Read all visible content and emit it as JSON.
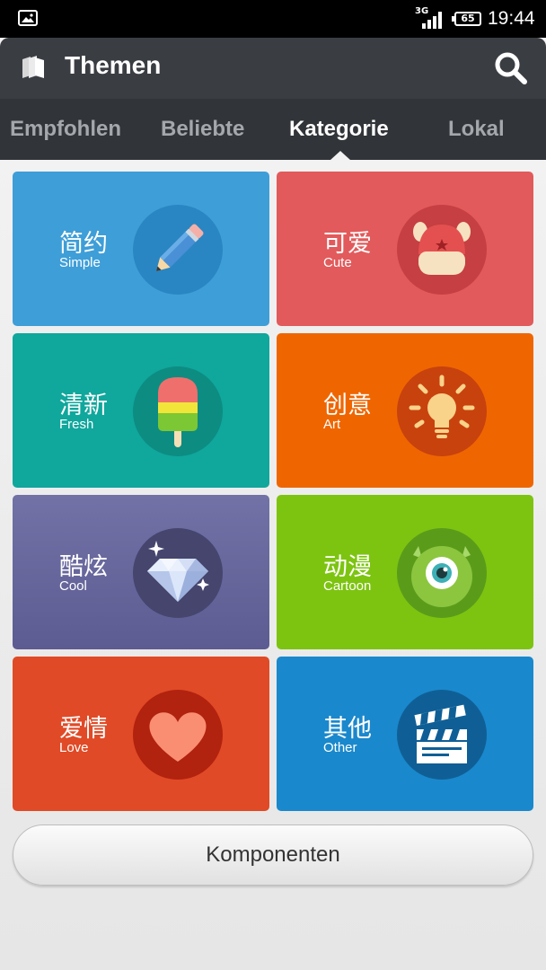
{
  "status_bar": {
    "network": "3G",
    "battery": "65",
    "time": "19:44"
  },
  "header": {
    "title": "Themen"
  },
  "tabs": [
    {
      "label": "Empfohlen",
      "active": false
    },
    {
      "label": "Beliebte",
      "active": false
    },
    {
      "label": "Kategorie",
      "active": true
    },
    {
      "label": "Lokal",
      "active": false
    }
  ],
  "categories": [
    {
      "cn": "简约",
      "en": "Simple",
      "color": "#3e9ed8",
      "icon": "pencil-icon"
    },
    {
      "cn": "可爱",
      "en": "Cute",
      "color": "#e25a5b",
      "icon": "cute-face-icon"
    },
    {
      "cn": "清新",
      "en": "Fresh",
      "color": "#10a79c",
      "icon": "popsicle-icon"
    },
    {
      "cn": "创意",
      "en": "Art",
      "color": "#ef6601",
      "icon": "lightbulb-icon"
    },
    {
      "cn": "酷炫",
      "en": "Cool",
      "color": "#6a6a9f",
      "icon": "diamond-icon"
    },
    {
      "cn": "动漫",
      "en": "Cartoon",
      "color": "#7dc410",
      "icon": "eyeball-monster-icon"
    },
    {
      "cn": "爱情",
      "en": "Love",
      "color": "#e04a26",
      "icon": "heart-icon"
    },
    {
      "cn": "其他",
      "en": "Other",
      "color": "#1a88cc",
      "icon": "clapperboard-icon"
    }
  ],
  "footer": {
    "button_label": "Komponenten"
  }
}
